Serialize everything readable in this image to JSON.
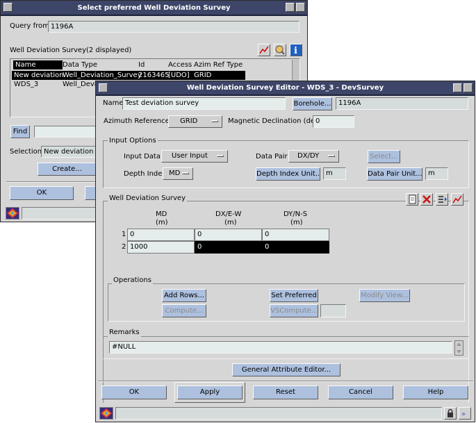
{
  "select_dialog": {
    "title": "Select preferred Well Deviation Survey",
    "query_label": "Query from",
    "query_value": "1196A",
    "list_title": "Well Deviation Survey(2 displayed)",
    "columns": [
      "Name",
      "Data Type",
      "Id",
      "Access",
      "Azim Ref Type"
    ],
    "rows": [
      {
        "name": "New deviation",
        "type": "Well_Deviation_Survey",
        "id": "2163465",
        "access": "[UDO]",
        "azim": "GRID"
      },
      {
        "name": "WDS_3",
        "type": "Well_Devia",
        "id": "",
        "access": "",
        "azim": ""
      }
    ],
    "find_label": "Find",
    "selection_label": "Selection",
    "selection_value": "New deviation -",
    "create_label": "Create...",
    "ok_label": "OK"
  },
  "editor": {
    "title": "Well Deviation Survey Editor - WDS_3 - DevSurvey",
    "name_label": "Name",
    "name_value": "Test deviation survey",
    "borehole_button": "Borehole...",
    "borehole_value": "1196A",
    "azimuth_label": "Azimuth Reference",
    "azimuth_value": "GRID",
    "declination_label": "Magnetic Declination (deg)",
    "declination_value": "0",
    "input_options": {
      "title": "Input Options",
      "input_data_label": "Input Data",
      "input_data_value": "User Input",
      "data_pair_label": "Data Pair",
      "data_pair_value": "DX/DY",
      "select_button": "Select...",
      "depth_index_label": "Depth Index",
      "depth_index_value": "MD",
      "depth_unit_button": "Depth Index Unit...",
      "depth_unit_value": "m",
      "pair_unit_button": "Data Pair Unit...",
      "pair_unit_value": "m"
    },
    "survey": {
      "title": "Well Deviation Survey",
      "columns": [
        {
          "name": "MD",
          "unit": "(m)"
        },
        {
          "name": "DX/E-W",
          "unit": "(m)"
        },
        {
          "name": "DY/N-S",
          "unit": "(m)"
        }
      ],
      "rows": [
        {
          "index": "1",
          "md": "0",
          "dx": "0",
          "dy": "0"
        },
        {
          "index": "2",
          "md": "1000",
          "dx": "0",
          "dy": "0"
        }
      ]
    },
    "operations": {
      "title": "Operations",
      "add_rows": "Add Rows...",
      "set_preferred": "Set Preferred",
      "modify_view": "Modify View...",
      "compute": "Compute...",
      "vs_compute": "VSCompute..."
    },
    "remarks": {
      "title": "Remarks",
      "value": "#NULL"
    },
    "general_attr_button": "General Attribute Editor...",
    "buttons": {
      "ok": "OK",
      "apply": "Apply",
      "reset": "Reset",
      "cancel": "Cancel",
      "help": "Help"
    }
  },
  "colors": {
    "title_bar": "#3d4568",
    "button_blue": "#adc0de",
    "window_bg": "#d6d6d6"
  }
}
